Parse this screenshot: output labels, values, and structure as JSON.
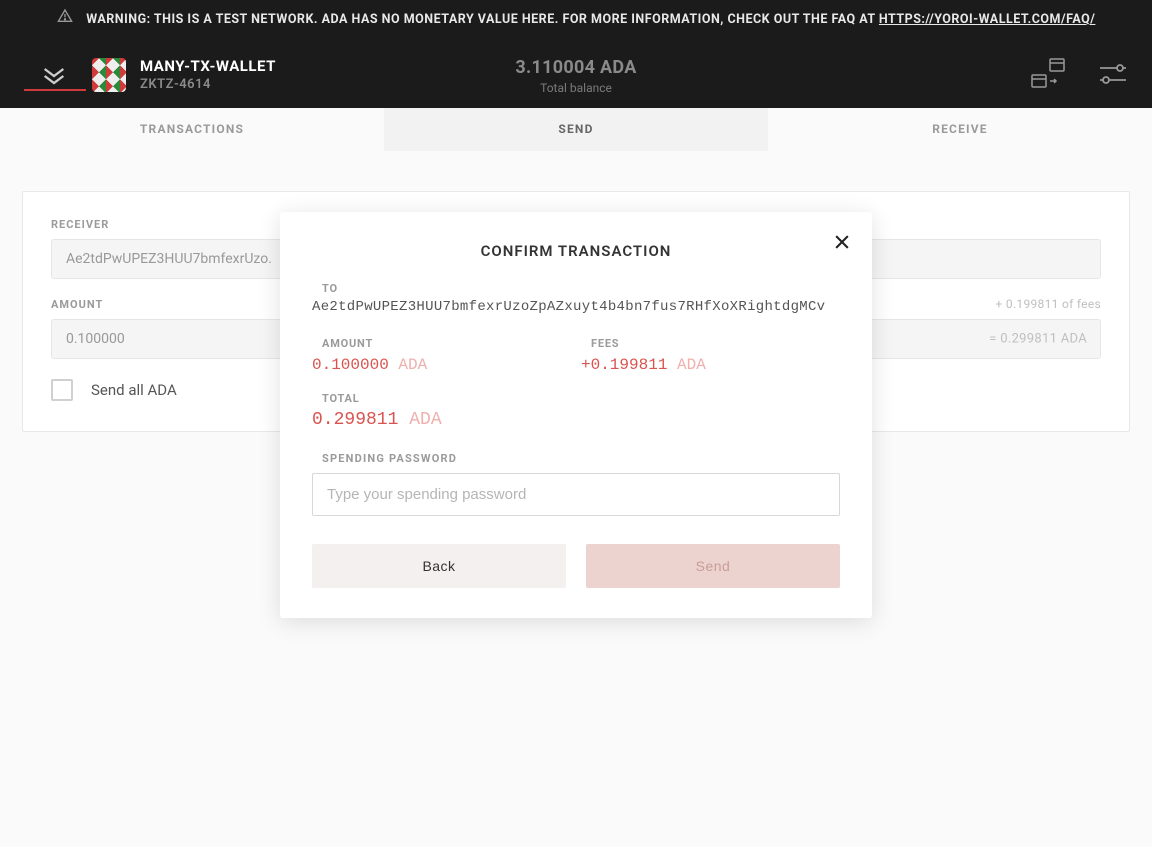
{
  "warning": {
    "text_before": "WARNING: THIS IS A TEST NETWORK. ADA HAS NO MONETARY VALUE HERE. FOR MORE INFORMATION, CHECK OUT THE FAQ AT ",
    "link_text": "HTTPS://YOROI-WALLET.COM/FAQ/"
  },
  "header": {
    "wallet_name": "MANY-TX-WALLET",
    "wallet_sub": "ZKTZ-4614",
    "balance_amount": "3.110004 ADA",
    "balance_label": "Total balance"
  },
  "tabs": {
    "transactions": "TRANSACTIONS",
    "send": "SEND",
    "receive": "RECEIVE"
  },
  "send_form": {
    "receiver_label": "RECEIVER",
    "receiver_value": "Ae2tdPwUPEZ3HUU7bmfexrUzo.",
    "amount_label": "AMOUNT",
    "amount_value": "0.100000",
    "fees_hint": "+ 0.199811 of fees",
    "total_hint": "= 0.299811 ADA",
    "send_all_label": "Send all ADA"
  },
  "modal": {
    "title": "CONFIRM TRANSACTION",
    "to_label": "TO",
    "to_value": "Ae2tdPwUPEZ3HUU7bmfexrUzoZpAZxuyt4b4bn7fus7RHfXoXRightdgMCv",
    "amount_label": "AMOUNT",
    "amount_value": "0.100000",
    "amount_suffix": " ADA",
    "fees_label": "FEES",
    "fees_value": "+0.199811",
    "fees_suffix": " ADA",
    "total_label": "TOTAL",
    "total_value": "0.299811",
    "total_suffix": " ADA",
    "password_label": "SPENDING PASSWORD",
    "password_placeholder": "Type your spending password",
    "back_label": "Back",
    "send_label": "Send"
  },
  "colors": {
    "accent_red": "#d9534f",
    "dark_bg": "#1b1b1b"
  }
}
